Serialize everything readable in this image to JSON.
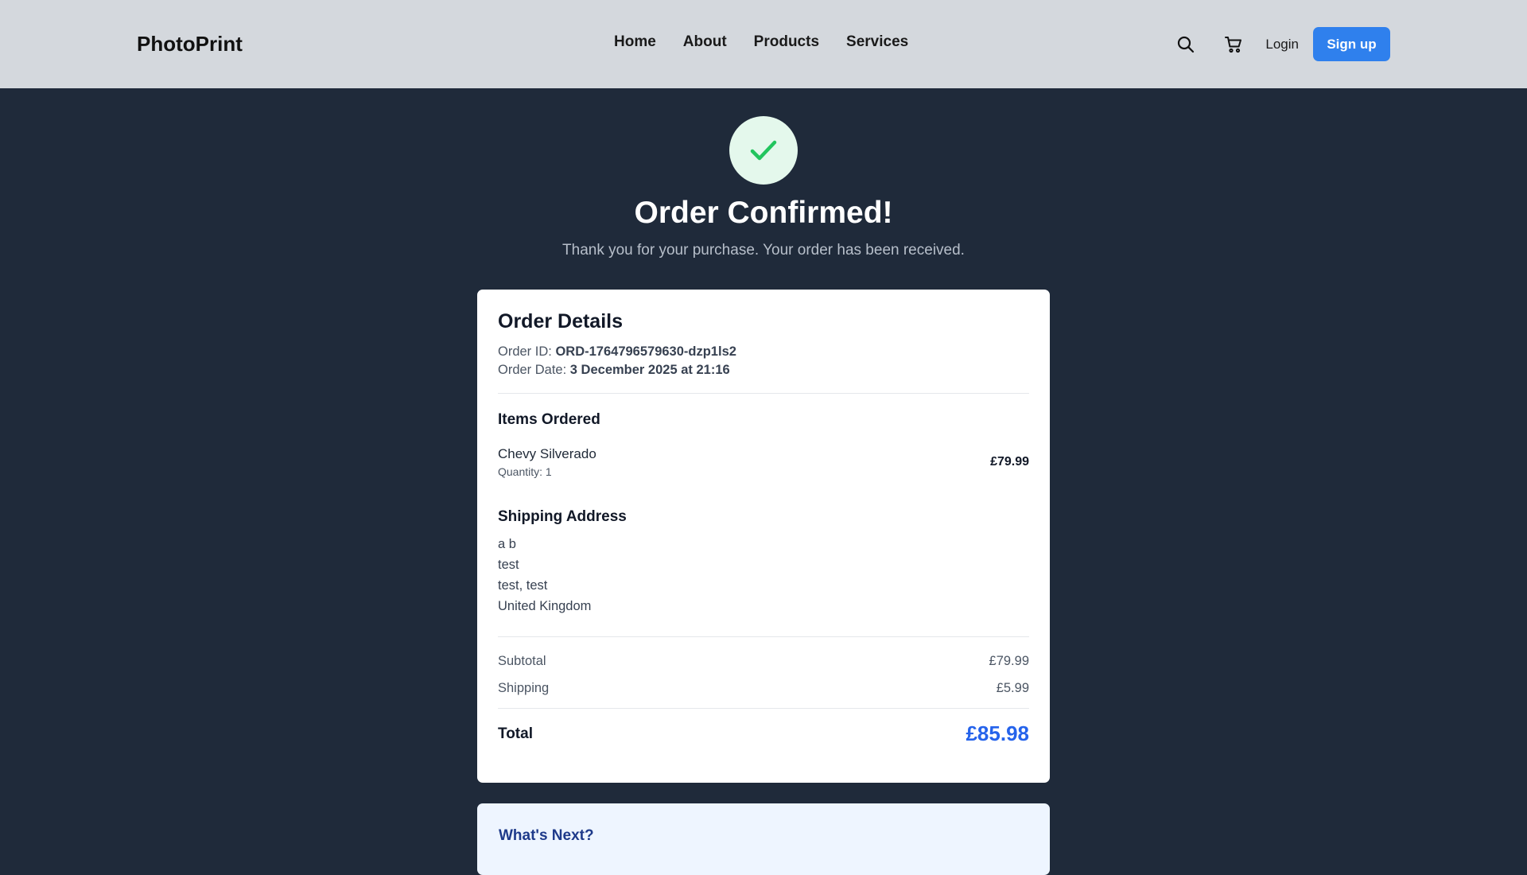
{
  "header": {
    "brand": "PhotoPrint",
    "nav": [
      "Home",
      "About",
      "Products",
      "Services"
    ],
    "login": "Login",
    "signup": "Sign up",
    "icons": [
      "search-icon",
      "cart-icon"
    ]
  },
  "hero": {
    "title": "Order Confirmed!",
    "subtitle": "Thank you for your purchase. Your order has been received.",
    "icon": "checkmark-icon"
  },
  "order": {
    "heading": "Order Details",
    "id_label": "Order ID:",
    "id_value": "ORD-1764796579630-dzp1ls2",
    "date_label": "Order Date:",
    "date_value": "3 December 2025 at 21:16",
    "items_heading": "Items Ordered",
    "items": [
      {
        "name": "Chevy Silverado",
        "quantity": "Quantity: 1",
        "price": "£79.99"
      }
    ],
    "shipping_heading": "Shipping Address",
    "address": [
      "a b",
      "test",
      "test, test",
      "United Kingdom"
    ],
    "subtotal_label": "Subtotal",
    "subtotal_value": "£79.99",
    "shipping_label": "Shipping",
    "shipping_value": "£5.99",
    "total_label": "Total",
    "total_value": "£85.98"
  },
  "next": {
    "heading": "What's Next?"
  },
  "colors": {
    "accent": "#2f80ed",
    "total": "#2563eb",
    "success": "#22c55e",
    "background": "#1f2a3a",
    "header_bg": "#d4d8dd"
  }
}
